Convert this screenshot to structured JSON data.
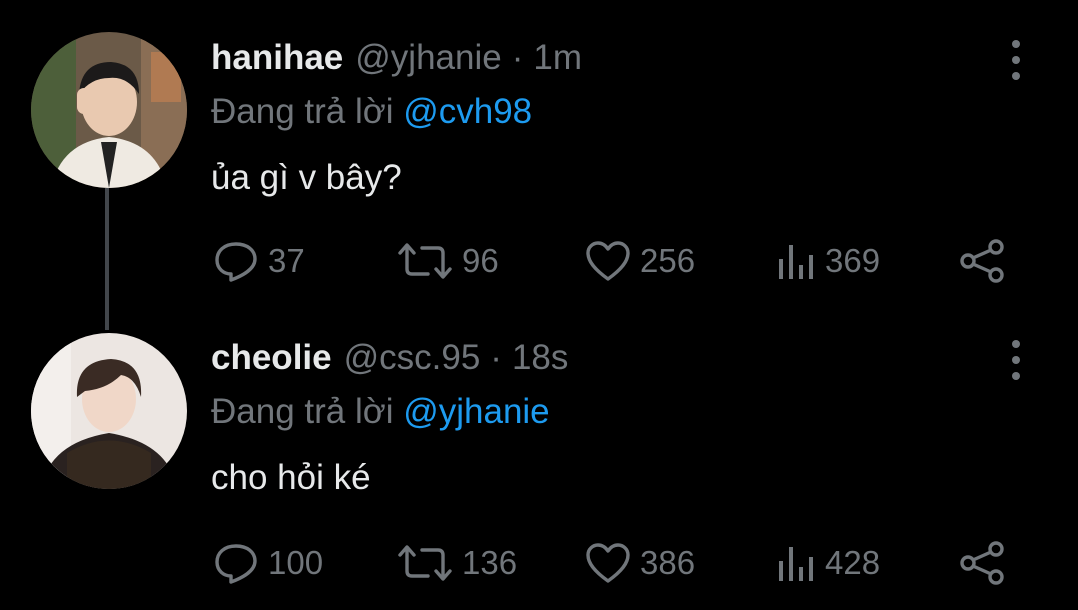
{
  "tweets": [
    {
      "display_name": "hanihae",
      "handle": "@yjhanie",
      "separator": "·",
      "time": "1m",
      "replying_prefix": "Đang trả lời",
      "replying_to": "@cvh98",
      "text": "ủa gì v bây?",
      "replies": "37",
      "retweets": "96",
      "likes": "256",
      "views": "369"
    },
    {
      "display_name": "cheolie",
      "handle": "@csc.95",
      "separator": "·",
      "time": "18s",
      "replying_prefix": "Đang trả lời",
      "replying_to": "@yjhanie",
      "text": "cho hỏi ké",
      "replies": "100",
      "retweets": "136",
      "likes": "386",
      "views": "428"
    }
  ],
  "icons": {
    "reply": "reply-icon",
    "retweet": "retweet-icon",
    "like": "heart-icon",
    "views": "views-icon",
    "share": "share-icon",
    "more": "more-vertical-icon"
  },
  "colors": {
    "background": "#000000",
    "primary_text": "#e7e9ea",
    "secondary_text": "#71767b",
    "accent": "#1d9bf0",
    "thread_line": "#42464b"
  }
}
